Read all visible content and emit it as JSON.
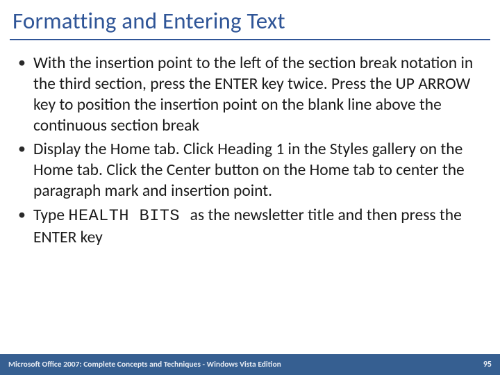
{
  "slide": {
    "title": "Formatting and Entering Text",
    "bullets": [
      {
        "segments": [
          {
            "text": "With the insertion point to the left of the section break notation in the third section, press the ENTER key twice. Press the UP ARROW key to position the insertion point on the blank line above the continuous section break",
            "mono": false
          }
        ]
      },
      {
        "segments": [
          {
            "text": "Display the Home tab. Click Heading 1 in the Styles gallery on the Home tab. Click the Center button on the Home tab to center the paragraph mark and insertion point.",
            "mono": false
          }
        ]
      },
      {
        "segments": [
          {
            "text": "Type ",
            "mono": false
          },
          {
            "text": "HEALTH BITS ",
            "mono": true
          },
          {
            "text": " as the newsletter title and then press the ENTER key",
            "mono": false
          }
        ]
      }
    ]
  },
  "footer": {
    "left": "Microsoft Office 2007: Complete Concepts and Techniques - Windows Vista Edition",
    "right": "95"
  }
}
